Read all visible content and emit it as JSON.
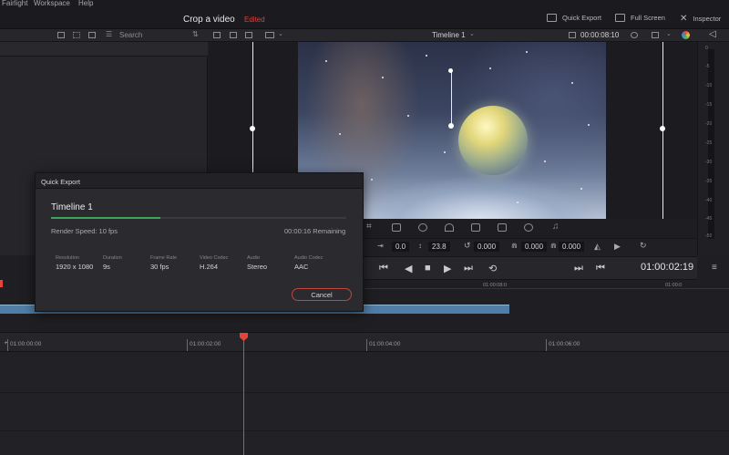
{
  "menu": {
    "items": [
      "Fairlight",
      "Workspace",
      "Help"
    ]
  },
  "project": {
    "title": "Crop a video",
    "status": "Edited"
  },
  "top_right": {
    "quick_export": "Quick Export",
    "full_screen": "Full Screen",
    "inspector": "Inspector"
  },
  "toolbar": {
    "search_label": "Search",
    "timeline_name": "Timeline 1",
    "viewer_timecode": "00:00:08:10"
  },
  "inspector_strip": {
    "values": [
      "0.0",
      "23.8",
      "0.000",
      "0.000",
      "0.000"
    ]
  },
  "transport": {
    "record_timecode": "01:00:02:19"
  },
  "meter": {
    "ticks": [
      "0",
      "-5",
      "-10",
      "-15",
      "-20",
      "-25",
      "-30",
      "-35",
      "-40",
      "-45",
      "-50"
    ]
  },
  "timeline": {
    "mini_ruler": [
      "01:00:08:0",
      "01:00:0"
    ],
    "ruler": [
      "01:00:00:00",
      "01:00:02:00",
      "01:00:04:00",
      "01:00:06:00"
    ]
  },
  "quick_export": {
    "header": "Quick Export",
    "name": "Timeline 1",
    "progress": 0.37,
    "render_speed": "Render Speed: 10 fps",
    "remaining": "00:00:16 Remaining",
    "specs": [
      {
        "label": "Resolution",
        "value": "1920 x 1080"
      },
      {
        "label": "Duration",
        "value": "9s"
      },
      {
        "label": "Frame Rate",
        "value": "30 fps"
      },
      {
        "label": "Video Codec",
        "value": "H.264"
      },
      {
        "label": "Audio",
        "value": "Stereo"
      },
      {
        "label": "Audio Codec",
        "value": "AAC"
      }
    ],
    "cancel_label": "Cancel"
  },
  "colors": {
    "accent_red": "#e3453c",
    "progress_green": "#3ca35a",
    "clip_blue": "#4f7ea8"
  }
}
